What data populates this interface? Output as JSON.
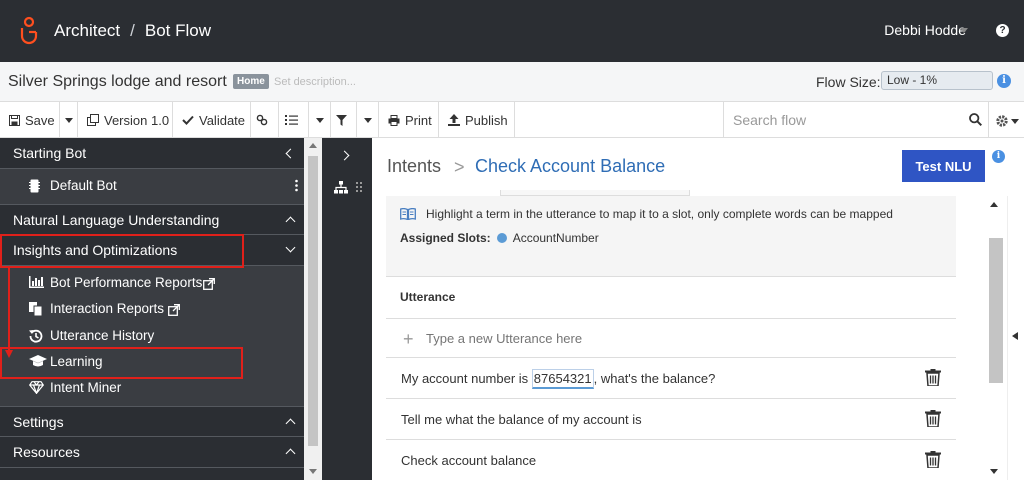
{
  "header": {
    "app_name": "Architect",
    "separator": "/",
    "section": "Bot Flow",
    "user_name": "Debbi Hodde",
    "help_label": "?"
  },
  "flow": {
    "name": "Silver Springs lodge and resort",
    "badge": "Home",
    "description_placeholder": "Set description...",
    "size_label": "Flow Size:",
    "size_value": "Low - 1%",
    "size_info": "i"
  },
  "toolbar": {
    "save_label": "Save",
    "version_label": "Version 1.0",
    "validate_label": "Validate",
    "print_label": "Print",
    "publish_label": "Publish",
    "search_placeholder": "Search flow"
  },
  "sidebar": {
    "sections": [
      {
        "label": "Starting Bot"
      },
      {
        "label": "Natural Language Understanding"
      },
      {
        "label": "Insights and Optimizations"
      },
      {
        "label": "Settings"
      },
      {
        "label": "Resources"
      }
    ],
    "starting_bot_items": [
      {
        "label": "Default Bot"
      }
    ],
    "insights_items": [
      {
        "label": "Bot Performance Reports"
      },
      {
        "label": "Interaction Reports"
      },
      {
        "label": "Utterance History"
      },
      {
        "label": "Learning"
      },
      {
        "label": "Intent Miner"
      }
    ]
  },
  "main": {
    "breadcrumb_root": "Intents",
    "breadcrumb_sep": ">",
    "breadcrumb_current": "Check Account Balance",
    "test_button": "Test NLU",
    "info": "i",
    "hint": "Highlight a term in the utterance to map it to a slot, only complete words can be mapped",
    "assigned_slots_label": "Assigned Slots:",
    "assigned_slot": "AccountNumber",
    "utterance_header": "Utterance",
    "new_utterance_placeholder": "Type a new Utterance here",
    "utterances": [
      {
        "prefix": "My account number is ",
        "slot": "87654321",
        "suffix": ", what's the balance?"
      },
      {
        "text": "Tell me what the balance of my account is"
      },
      {
        "text": "Check account balance"
      }
    ]
  },
  "colors": {
    "header_bg": "#2b2e33",
    "sidebar_bg": "#3a3d42",
    "accent_blue": "#2f55c4",
    "link_blue": "#2f6db5",
    "highlight_red": "#e0201a",
    "slot_blue": "#5b9bd5"
  }
}
